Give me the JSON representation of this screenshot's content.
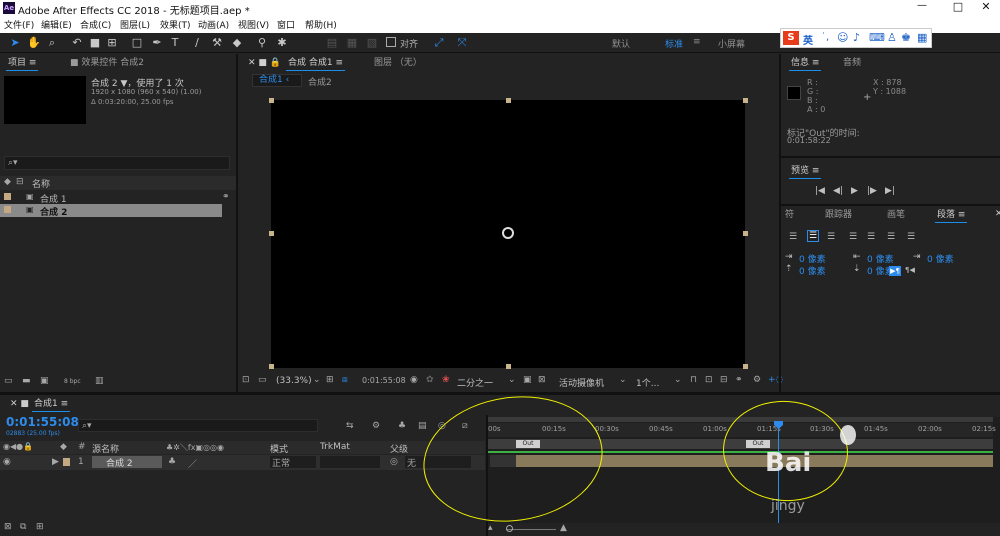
{
  "window": {
    "title": "Adobe After Effects CC 2018 - 无标题项目.aep *",
    "controls": [
      "—",
      "□",
      "✕"
    ]
  },
  "menu": [
    "文件(F)",
    "编辑(E)",
    "合成(C)",
    "图层(L)",
    "效果(T)",
    "动画(A)",
    "视图(V)",
    "窗口",
    "帮助(H)"
  ],
  "toolbar": {
    "align_label": "对齐",
    "workspaces": [
      "默认",
      "标准",
      "小屏幕"
    ],
    "active_workspace": "标准"
  },
  "ime": {
    "label": "英"
  },
  "project_panel": {
    "tabs": [
      "项目",
      "效果控件 合成2"
    ],
    "comp_name": "合成 2 ▼，使用了 1 次",
    "comp_size": "1920 x 1080 (960 x 540) (1.00)",
    "comp_duration": "Δ 0:03:20:00, 25.00 fps",
    "search_placeholder": "",
    "column_name": "名称",
    "items": [
      {
        "name": "合成 1",
        "selected": false
      },
      {
        "name": "合成 2",
        "selected": true
      }
    ],
    "bpc": "8 bpc"
  },
  "comp_panel": {
    "tabs": [
      "合成 合成1",
      "图层 （无）"
    ],
    "subtabs": [
      "合成1",
      "合成2"
    ],
    "zoom": "(33.3%)",
    "timecode": "0:01:55:08",
    "resolution": "二分之一",
    "camera": "活动摄像机",
    "views": "1个...",
    "bg_color": "#000000"
  },
  "info_panel": {
    "tabs": [
      "信息",
      "音频"
    ],
    "r": "R :",
    "g": "G :",
    "b": "B :",
    "a": "A : 0",
    "x": "X : 878",
    "y": "Y : 1088",
    "marker_label": "标记\"Out\"的时间:",
    "marker_time": "0:01:58:22"
  },
  "preview_panel": {
    "title": "预览"
  },
  "paragraph_panel": {
    "tabs": [
      "符",
      "跟踪器",
      "画笔",
      "段落"
    ],
    "fields": [
      "0 像素",
      "0 像素",
      "0 像素",
      "0 像素",
      "0 像素"
    ]
  },
  "timeline": {
    "tab": "合成1",
    "timecode": "0:01:55:08",
    "frames": "02883 (25.00 fps)",
    "col_source": "源名称",
    "col_mode": "模式",
    "col_trkmat": "TrkMat",
    "col_parent": "父级",
    "ruler": [
      "00s",
      "00:15s",
      "00:30s",
      "00:45s",
      "01:00s",
      "01:15s",
      "01:30s",
      "01:45s",
      "02:00s",
      "02:15s"
    ],
    "marker_label": "Out",
    "layer": {
      "num": "1",
      "name": "合成 2",
      "mode": "正常",
      "parent": "无"
    },
    "playhead_fraction": 0.575,
    "accent": "#2d8ceb"
  },
  "watermark": {
    "text": "Bai",
    "sub": "jingy"
  }
}
